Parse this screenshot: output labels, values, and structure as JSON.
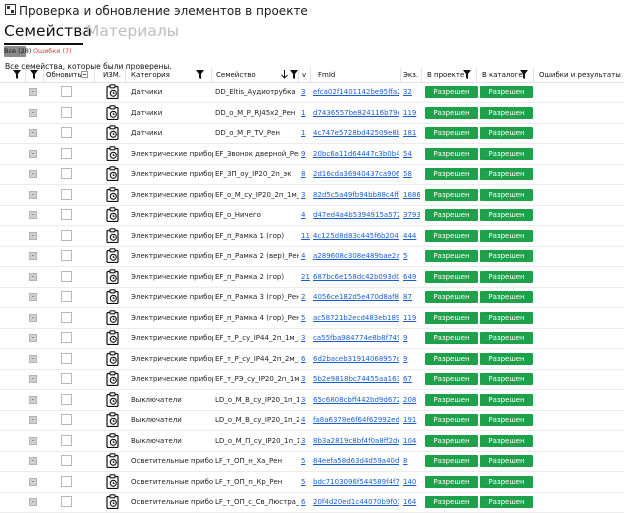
{
  "window": {
    "title": "Проверка и обновление элементов в проекте",
    "icon": "app-icon"
  },
  "tabs": [
    {
      "label": "Семейства",
      "active": true
    },
    {
      "label": "Материалы",
      "active": false
    }
  ],
  "filters": {
    "all": "Все (28)",
    "errors": "Ошибки (7)"
  },
  "info_text": "Все семейства, которые были проверены.",
  "columns": {
    "update": "Обновить",
    "changed": "ИЗМ.",
    "category": "Категория",
    "family": "Семейство",
    "version": "v",
    "fmid": "FmId",
    "instances": "Экз.",
    "in_project": "В проекте",
    "in_catalog": "В каталоге",
    "errors": "Ошибки и результаты"
  },
  "status_label": "Разрешен",
  "colors": {
    "ok_button": "#1ea14a",
    "link": "#1a5fd1",
    "error_chip": "#e53935"
  },
  "rows": [
    {
      "cat": "Датчики",
      "fam": "DD_Eltis_Аудиотрубка",
      "v": "3",
      "fmid": "efca02f1401142be95ffa28efb",
      "ex": "32"
    },
    {
      "cat": "Датчики",
      "fam": "DD_o_M_P_RJ45x2_Рен",
      "v": "1",
      "fmid": "d7436557be824116b79e7b2",
      "ex": "119"
    },
    {
      "cat": "Датчики",
      "fam": "DD_o_M_P_TV_Рен",
      "v": "1",
      "fmid": "4c747e5728bd42509e8b7e53",
      "ex": "181"
    },
    {
      "cat": "Электрические приборы",
      "fam": "EF_Звонок дверной_Рен",
      "v": "9",
      "fmid": "20bc6a11d64447c3b0b4979",
      "ex": "54"
    },
    {
      "cat": "Электрические приборы",
      "fam": "EF_ЗП_oy_IP20_2п_эк",
      "v": "8",
      "fmid": "2d16cda36940437ca906d8d",
      "ex": "58"
    },
    {
      "cat": "Электрические приборы",
      "fam": "EF_o_M_cy_IP20_2п_1м_эк",
      "v": "3",
      "fmid": "82d5c5a49fb94bb88c4ff1e1",
      "ex": "1686"
    },
    {
      "cat": "Электрические приборы",
      "fam": "EF_o_Ничего",
      "v": "4",
      "fmid": "d47ed4a4b5394915a572c67",
      "ex": "3793"
    },
    {
      "cat": "Электрические приборы",
      "fam": "EF_п_Рамка 1 (гор)",
      "v": "11",
      "fmid": "4c125d8d83c445f6b204c75f",
      "ex": "444"
    },
    {
      "cat": "Электрические приборы",
      "fam": "EF_п_Рамка 2 (вер)_Рен",
      "v": "4",
      "fmid": "a289608c308e489bae2a1f0a",
      "ex": "5"
    },
    {
      "cat": "Электрические приборы",
      "fam": "EF_п_Рамка 2 (гор)",
      "v": "21",
      "fmid": "687bc6e158dc42b093d0631",
      "ex": "649"
    },
    {
      "cat": "Электрические приборы",
      "fam": "EF_п_Рамка 3 (гор)_Рен",
      "v": "2",
      "fmid": "4056ce182d5e470d8af8156",
      "ex": "87"
    },
    {
      "cat": "Электрические приборы",
      "fam": "EF_п_Рамка 4 (гор)_Рен",
      "v": "5",
      "fmid": "ac58721b2ecd483eb18943f",
      "ex": "119"
    },
    {
      "cat": "Электрические приборы",
      "fam": "EF_т_P_cy_IP44_2п_1м_эк",
      "v": "3",
      "fmid": "ca55fba984774e8b8f749a43",
      "ex": "9"
    },
    {
      "cat": "Электрические приборы",
      "fam": "EF_т_P_cy_IP44_2п_2м_эк",
      "v": "6",
      "fmid": "6d2baceb31914068957d9c3",
      "ex": "9"
    },
    {
      "cat": "Электрические приборы",
      "fam": "EF_т_PЭ_cy_IP20_2п_1м_з",
      "v": "3",
      "fmid": "5b2e9818bc74455aa163706",
      "ex": "67"
    },
    {
      "cat": "Выключатели",
      "fam": "LD_o_M_B_cy_IP20_1п_1к",
      "v": "3",
      "fmid": "65c6808cbff442bd9d672cd",
      "ex": "208"
    },
    {
      "cat": "Выключатели",
      "fam": "LD_o_M_B_cy_IP20_1п_2к",
      "v": "4",
      "fmid": "fa8a6378e6f64f62992edc96",
      "ex": "191"
    },
    {
      "cat": "Выключатели",
      "fam": "LD_o_M_П_cy_IP20_1п_1к",
      "v": "3",
      "fmid": "8b3a2819c8bf4f0a8ff2de9e",
      "ex": "104"
    },
    {
      "cat": "Осветительные прибор",
      "fam": "LF_т_ОП_н_Ха_Рен",
      "v": "5",
      "fmid": "84eefa58d63d4d59a40d700",
      "ex": "8"
    },
    {
      "cat": "Осветительные прибор",
      "fam": "LF_т_ОП_п_Кр_Рен",
      "v": "5",
      "fmid": "bdc7103096f544589f4f74dd",
      "ex": "140"
    },
    {
      "cat": "Осветительные прибор",
      "fam": "LF_т_ОП_с_Св_Люстра_Ре",
      "v": "6",
      "fmid": "20f4d20ed1c44070b9f01bf5",
      "ex": "164"
    }
  ]
}
